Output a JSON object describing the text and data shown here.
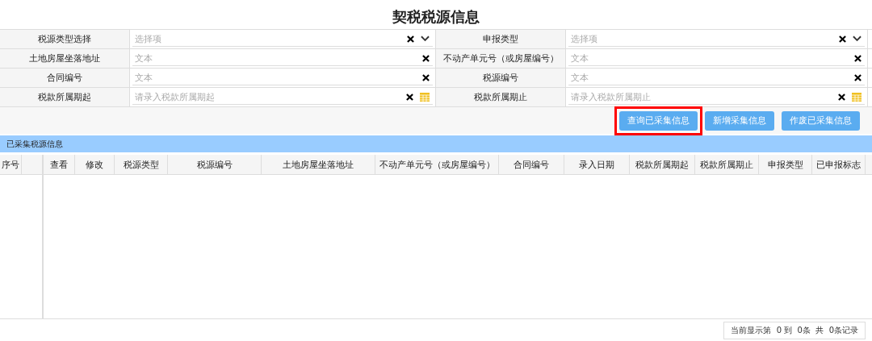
{
  "title": "契税税源信息",
  "form_rows": [
    [
      {
        "label": "税源类型选择",
        "kind": "select",
        "placeholder": "选择项"
      },
      {
        "label": "申报类型",
        "kind": "select",
        "placeholder": "选择项"
      }
    ],
    [
      {
        "label": "土地房屋坐落地址",
        "kind": "text",
        "placeholder": "文本"
      },
      {
        "label": "不动产单元号（或房屋编号）",
        "kind": "text",
        "placeholder": "文本"
      }
    ],
    [
      {
        "label": "合同编号",
        "kind": "text",
        "placeholder": "文本"
      },
      {
        "label": "税源编号",
        "kind": "text",
        "placeholder": "文本"
      }
    ],
    [
      {
        "label": "税款所属期起",
        "kind": "date",
        "placeholder": "请录入税款所属期起"
      },
      {
        "label": "税款所属期止",
        "kind": "date",
        "placeholder": "请录入税款所属期止"
      }
    ]
  ],
  "buttons": [
    {
      "label": "查询已采集信息",
      "highlighted": true
    },
    {
      "label": "新增采集信息",
      "highlighted": false
    },
    {
      "label": "作废已采集信息",
      "highlighted": false
    }
  ],
  "section_title": "已采集税源信息",
  "table": {
    "frozen_columns": [
      "序号"
    ],
    "columns": [
      "查看",
      "修改",
      "税源类型",
      "税源编号",
      "土地房屋坐落地址",
      "不动产单元号（或房屋编号）",
      "合同编号",
      "录入日期",
      "税款所属期起",
      "税款所属期止",
      "申报类型",
      "已申报标志"
    ]
  },
  "pager": "当前显示第  0 到  0条  共  0条记录"
}
